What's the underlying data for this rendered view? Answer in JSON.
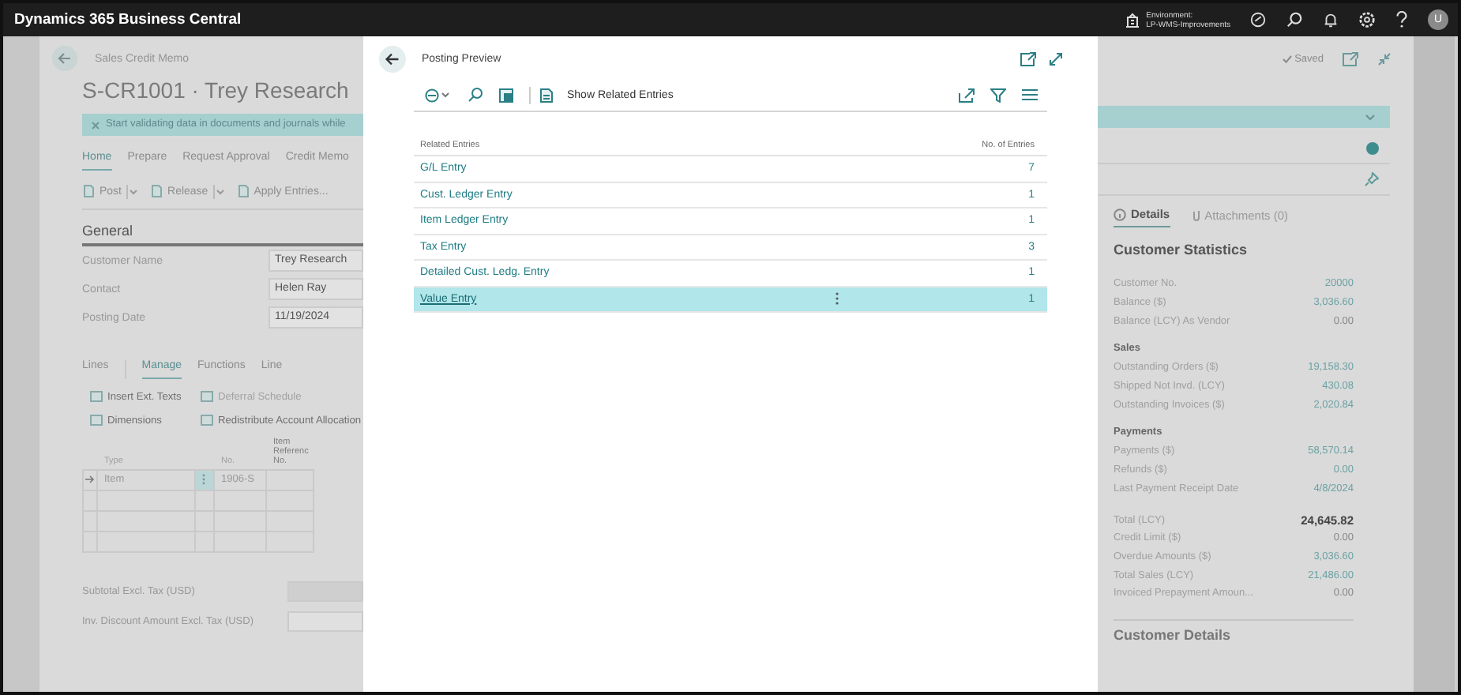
{
  "app_bar": {
    "title": "Dynamics 365 Business Central",
    "environment_label": "Environment:",
    "environment_name": "LP-WMS-Improvements",
    "avatar": "U"
  },
  "page": {
    "breadcrumb": "Sales Credit Memo",
    "title": "S-CR1001 · Trey Research",
    "banner": "Start validating data in documents and journals while",
    "tabs": [
      {
        "label": "Home",
        "selected": true
      },
      {
        "label": "Prepare",
        "selected": false
      },
      {
        "label": "Request Approval",
        "selected": false
      },
      {
        "label": "Credit Memo",
        "selected": false
      }
    ],
    "actions": [
      {
        "label": "Post",
        "menu": true
      },
      {
        "label": "Release",
        "menu": true
      },
      {
        "label": "Apply Entries...",
        "menu": false
      }
    ],
    "section_title": "General",
    "fields": [
      {
        "label": "Customer Name",
        "value": "Trey Research"
      },
      {
        "label": "Contact",
        "value": "Helen Ray"
      },
      {
        "label": "Posting Date",
        "value": "11/19/2024"
      }
    ],
    "lines": {
      "title": "Lines",
      "tabs": [
        {
          "label": "Manage",
          "selected": true
        },
        {
          "label": "Functions",
          "selected": false
        },
        {
          "label": "Line",
          "selected": false
        }
      ],
      "actions": [
        {
          "label": "Insert Ext. Texts",
          "disabled": false
        },
        {
          "label": "Deferral Schedule",
          "disabled": true
        },
        {
          "label": "Dimensions",
          "disabled": false
        },
        {
          "label": "Redistribute Account Allocation",
          "disabled": false
        }
      ],
      "columns": [
        "Type",
        "No.",
        "Item Referenc No."
      ],
      "row": {
        "type": "Item",
        "no": "1906-S"
      }
    },
    "totals": [
      {
        "label": "Subtotal Excl. Tax (USD)"
      },
      {
        "label": "Inv. Discount Amount Excl. Tax (USD)"
      }
    ]
  },
  "posting_preview": {
    "title": "Posting Preview",
    "toolbar_action": "Show Related Entries",
    "columns": [
      "Related Entries",
      "No. of Entries"
    ],
    "rows": [
      {
        "entry": "G/L Entry",
        "count": "7",
        "selected": false
      },
      {
        "entry": "Cust. Ledger Entry",
        "count": "1",
        "selected": false
      },
      {
        "entry": "Item Ledger Entry",
        "count": "1",
        "selected": false
      },
      {
        "entry": "Tax Entry",
        "count": "3",
        "selected": false
      },
      {
        "entry": "Detailed Cust. Ledg. Entry",
        "count": "1",
        "selected": false
      },
      {
        "entry": "Value Entry",
        "count": "1",
        "selected": true
      }
    ]
  },
  "factbox": {
    "status": "Saved",
    "tabs": [
      {
        "label": "Details",
        "selected": true
      },
      {
        "label": "Attachments (0)",
        "selected": false
      }
    ],
    "heading": "Customer Statistics",
    "groups": [
      {
        "rows": [
          {
            "label": "Customer No.",
            "value": "20000",
            "kind": "link"
          },
          {
            "label": "Balance ($)",
            "value": "3,036.60",
            "kind": "link"
          },
          {
            "label": "Balance (LCY) As Vendor",
            "value": "0.00",
            "kind": "plain"
          }
        ]
      },
      {
        "heading": "Sales",
        "rows": [
          {
            "label": "Outstanding Orders ($)",
            "value": "19,158.30",
            "kind": "link"
          },
          {
            "label": "Shipped Not Invd. (LCY)",
            "value": "430.08",
            "kind": "link"
          },
          {
            "label": "Outstanding Invoices ($)",
            "value": "2,020.84",
            "kind": "link"
          }
        ]
      },
      {
        "heading": "Payments",
        "rows": [
          {
            "label": "Payments ($)",
            "value": "58,570.14",
            "kind": "link"
          },
          {
            "label": "Refunds ($)",
            "value": "0.00",
            "kind": "link"
          },
          {
            "label": "Last Payment Receipt Date",
            "value": "4/8/2024",
            "kind": "link"
          }
        ]
      },
      {
        "rows": [
          {
            "label": "Total (LCY)",
            "value": "24,645.82",
            "kind": "bold"
          },
          {
            "label": "Credit Limit ($)",
            "value": "0.00",
            "kind": "plain"
          },
          {
            "label": "Overdue Amounts ($)",
            "value": "3,036.60",
            "kind": "link"
          },
          {
            "label": "Total Sales (LCY)",
            "value": "21,486.00",
            "kind": "link"
          },
          {
            "label": "Invoiced Prepayment Amoun...",
            "value": "0.00",
            "kind": "plain"
          }
        ]
      }
    ],
    "next_heading": "Customer Details"
  }
}
